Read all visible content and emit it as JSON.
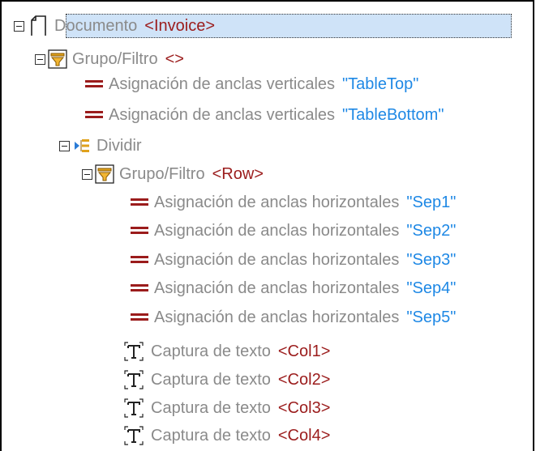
{
  "tree": {
    "root": {
      "label": "Documento",
      "tag": "<Invoice>"
    },
    "filter1": {
      "label": "Grupo/Filtro",
      "tag": "<>"
    },
    "v_anchors": [
      {
        "label": "Asignación de anclas verticales",
        "value": "\"TableTop\""
      },
      {
        "label": "Asignación de anclas verticales",
        "value": "\"TableBottom\""
      }
    ],
    "split": {
      "label": "Dividir"
    },
    "filter2": {
      "label": "Grupo/Filtro",
      "tag": "<Row>"
    },
    "h_anchors": [
      {
        "label": "Asignación de anclas horizontales",
        "value": "\"Sep1\""
      },
      {
        "label": "Asignación de anclas horizontales",
        "value": "\"Sep2\""
      },
      {
        "label": "Asignación de anclas horizontales",
        "value": "\"Sep3\""
      },
      {
        "label": "Asignación de anclas horizontales",
        "value": "\"Sep4\""
      },
      {
        "label": "Asignación de anclas horizontales",
        "value": "\"Sep5\""
      }
    ],
    "captures": [
      {
        "label": "Captura de texto",
        "tag": "<Col1>"
      },
      {
        "label": "Captura de texto",
        "tag": "<Col2>"
      },
      {
        "label": "Captura de texto",
        "tag": "<Col3>"
      },
      {
        "label": "Captura de texto",
        "tag": "<Col4>"
      }
    ]
  },
  "colors": {
    "selection": "#cfe3f8",
    "tag": "#9b1c1c",
    "string": "#1e88e5",
    "label": "#8a8a8a"
  },
  "icons": [
    "collapse-toggle",
    "document-icon",
    "filter-icon",
    "assign-equals-icon",
    "split-icon",
    "text-capture-icon"
  ]
}
